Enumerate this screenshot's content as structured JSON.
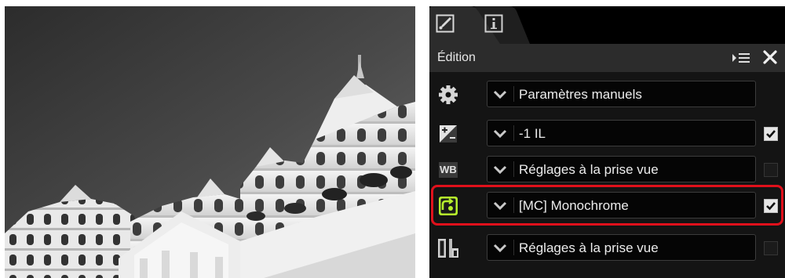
{
  "photo": {
    "alt": ""
  },
  "panel": {
    "tabs": [
      {
        "icon": "edit-brush-icon",
        "active": true
      },
      {
        "icon": "info-icon",
        "active": false
      }
    ],
    "header": {
      "title": "Édition",
      "menu_icon": "panel-menu-icon",
      "close_icon": "close-icon"
    },
    "rows": [
      {
        "icon": "gear-icon",
        "label": "Paramètres manuels",
        "checkbox": null
      },
      {
        "icon": "exposure-compensation-icon",
        "label": "-1 IL",
        "checkbox": true
      },
      {
        "icon": "white-balance-icon",
        "icon_text": "WB",
        "label": "Réglages à la prise vue",
        "checkbox": false
      },
      {
        "icon": "picture-control-icon",
        "label": "[MC] Monochrome",
        "checkbox": true,
        "highlighted": true
      },
      {
        "icon": "tone-curve-icon",
        "label": "Réglages à la prise vue",
        "checkbox": false
      }
    ]
  },
  "colors": {
    "highlight": "#e0101b",
    "picture_control_icon": "#b6ef2c",
    "panel_bg": "#141414",
    "header_bg": "#2c2c2c"
  }
}
